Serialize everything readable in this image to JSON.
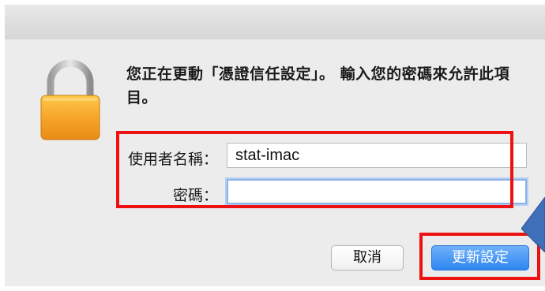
{
  "dialog": {
    "message": "您正在更動「憑證信任設定」。 輸入您的密碼來允許此項目。"
  },
  "form": {
    "username_label": "使用者名稱：",
    "username_value": "stat-imac",
    "password_label": "密碼：",
    "password_value": ""
  },
  "buttons": {
    "cancel_label": "取消",
    "update_label": "更新設定"
  },
  "icons": {
    "lock": "lock-icon"
  },
  "colors": {
    "highlight_box": "#ee1111",
    "primary_button": "#2e86f0",
    "lock_body": "#f5a623"
  }
}
